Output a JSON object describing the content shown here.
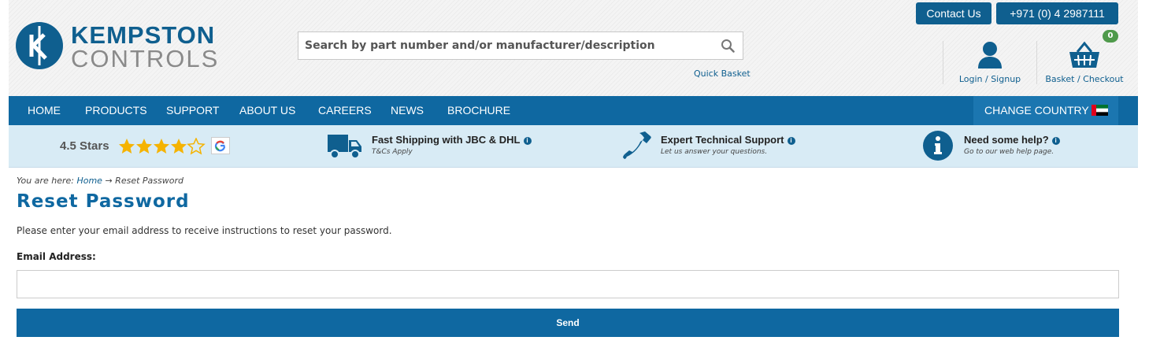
{
  "header": {
    "logo_line1": "KEMPSTON",
    "logo_line2": "CONTROLS",
    "search_placeholder": "Search by part number and/or manufacturer/description",
    "quick_basket": "Quick Basket",
    "contact_label": "Contact Us",
    "phone_label": "+971 (0) 4 2987111",
    "login_label": "Login / Signup",
    "basket_label": "Basket / Checkout",
    "basket_count": "0"
  },
  "nav": {
    "items": [
      "HOME",
      "PRODUCTS",
      "SUPPORT",
      "ABOUT US",
      "CAREERS",
      "NEWS",
      "BROCHURE"
    ],
    "change_country": "CHANGE COUNTRY"
  },
  "features": {
    "rating_text": "4.5 Stars",
    "rating_value": 4.5,
    "rating_max": 5,
    "shipping_title": "Fast Shipping with JBC & DHL",
    "shipping_sub": "T&Cs Apply",
    "support_title": "Expert Technical Support",
    "support_sub": "Let us answer your questions.",
    "help_title": "Need some help?",
    "help_sub": "Go to our web help page."
  },
  "breadcrumb": {
    "prefix": "You are here: ",
    "home": "Home",
    "separator": " → ",
    "current": "Reset Password"
  },
  "main": {
    "title": "Reset Password",
    "description": "Please enter your email address to receive instructions to reset your password.",
    "email_label": "Email Address:",
    "email_value": "",
    "send_label": "Send"
  },
  "colors": {
    "brand_blue": "#0f68a1",
    "star_gold": "#f5b301",
    "badge_green": "#4f9a4b",
    "feature_band": "#d8ebf5"
  },
  "icons": [
    "search-icon",
    "user-icon",
    "basket-icon",
    "truck-icon",
    "phone-icon",
    "info-icon",
    "star-icon",
    "google-icon",
    "uae-flag-icon"
  ]
}
